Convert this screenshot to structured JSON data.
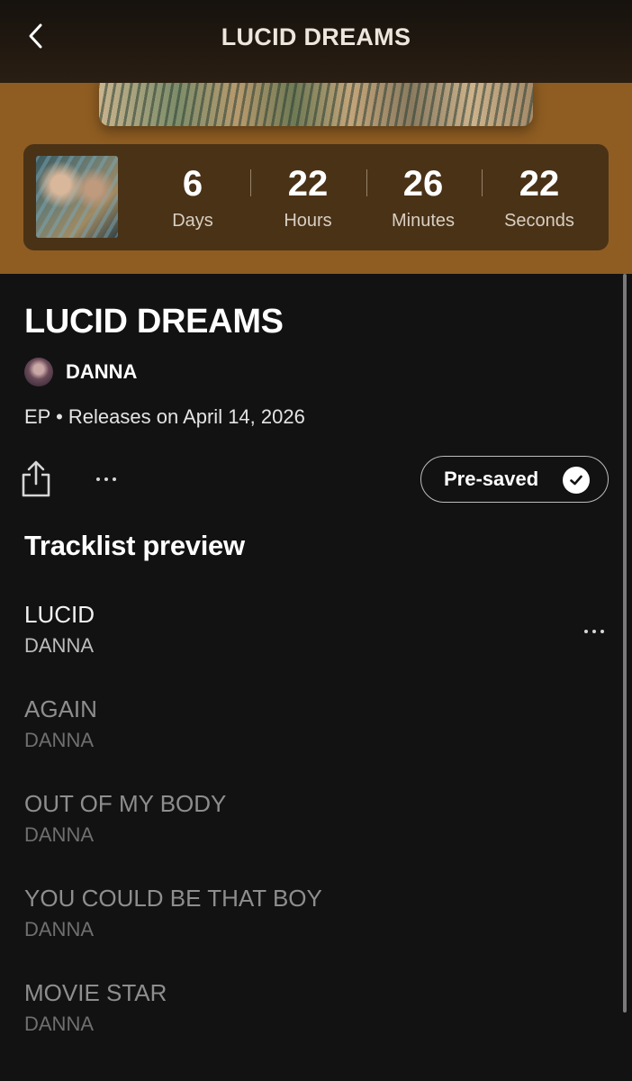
{
  "header": {
    "title": "LUCID DREAMS",
    "back_icon": "chevron-left-icon"
  },
  "countdown": [
    {
      "value": "6",
      "label": "Days"
    },
    {
      "value": "22",
      "label": "Hours"
    },
    {
      "value": "26",
      "label": "Minutes"
    },
    {
      "value": "22",
      "label": "Seconds"
    }
  ],
  "album": {
    "title": "LUCID DREAMS",
    "artist": "DANNA",
    "meta": "EP • Releases on April 14, 2026"
  },
  "actions": {
    "share_icon": "share-icon",
    "more_icon": "more-horizontal-icon",
    "presave_label": "Pre-saved",
    "presave_icon": "check-circle-icon"
  },
  "tracklist": {
    "title": "Tracklist preview",
    "tracks": [
      {
        "title": "LUCID",
        "artist": "DANNA"
      },
      {
        "title": "AGAIN",
        "artist": "DANNA"
      },
      {
        "title": "OUT OF MY BODY",
        "artist": "DANNA"
      },
      {
        "title": "YOU COULD BE THAT BOY",
        "artist": "DANNA"
      },
      {
        "title": "MOVIE STAR",
        "artist": "DANNA"
      }
    ]
  },
  "colors": {
    "hero_bg": "#8f5d22",
    "countdown_card": "#4a3217",
    "page_bg": "#121212"
  }
}
